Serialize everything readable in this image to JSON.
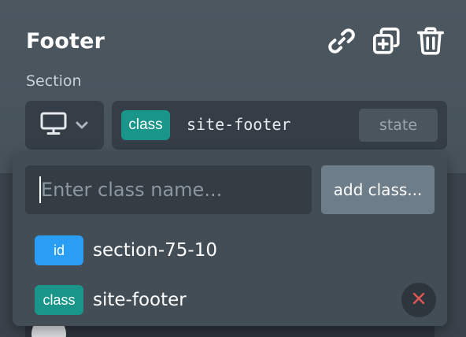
{
  "header": {
    "title": "Footer",
    "section_label": "Section"
  },
  "icons": {
    "link": "link-icon",
    "duplicate": "duplicate-icon",
    "delete": "trash-icon",
    "device": "desktop-icon",
    "chevron": "chevron-down-icon",
    "remove": "close-icon"
  },
  "selector": {
    "badge": "class",
    "value": "site-footer",
    "state_label": "state"
  },
  "dropdown": {
    "input_value": "",
    "input_placeholder": "Enter class name...",
    "add_label": "add class...",
    "items": [
      {
        "type": "id",
        "label": "section-75-10"
      },
      {
        "type": "class",
        "label": "site-footer"
      }
    ]
  },
  "colors": {
    "class_badge": "#19958a",
    "id_badge": "#2a9df4",
    "remove_x": "#e05555"
  }
}
